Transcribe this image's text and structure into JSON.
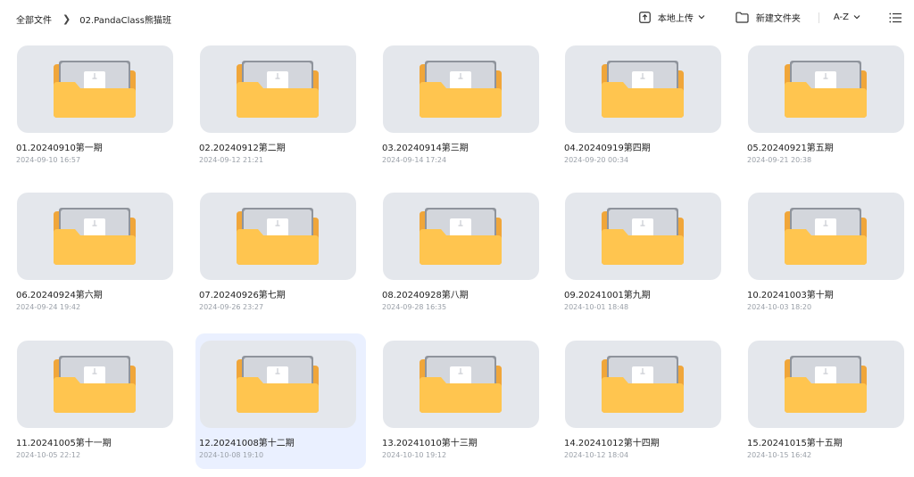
{
  "breadcrumb": {
    "root": "全部文件",
    "current": "02.PandaClass熊猫班"
  },
  "toolbar": {
    "upload_label": "本地上传",
    "new_folder_label": "新建文件夹",
    "sort_label": "A-Z",
    "icons": {
      "upload": "upload-icon",
      "folder": "folder-icon",
      "list": "list-view-icon"
    }
  },
  "colors": {
    "folder": "#ffc54f",
    "folder_back": "#f0a63a",
    "thumb_bg": "#e4e7ec",
    "selected_bg": "#eaf0ff"
  },
  "folders": [
    {
      "name": "01.20240910第一期",
      "date": "2024-09-10 16:57"
    },
    {
      "name": "02.20240912第二期",
      "date": "2024-09-12 21:21"
    },
    {
      "name": "03.20240914第三期",
      "date": "2024-09-14 17:24"
    },
    {
      "name": "04.20240919第四期",
      "date": "2024-09-20 00:34"
    },
    {
      "name": "05.20240921第五期",
      "date": "2024-09-21 20:38"
    },
    {
      "name": "06.20240924第六期",
      "date": "2024-09-24 19:42"
    },
    {
      "name": "07.20240926第七期",
      "date": "2024-09-26 23:27"
    },
    {
      "name": "08.20240928第八期",
      "date": "2024-09-28 16:35"
    },
    {
      "name": "09.20241001第九期",
      "date": "2024-10-01 18:48"
    },
    {
      "name": "10.20241003第十期",
      "date": "2024-10-03 18:20"
    },
    {
      "name": "11.20241005第十一期",
      "date": "2024-10-05 22:12"
    },
    {
      "name": "12.20241008第十二期",
      "date": "2024-10-08 19:10",
      "selected": true
    },
    {
      "name": "13.20241010第十三期",
      "date": "2024-10-10 19:12"
    },
    {
      "name": "14.20241012第十四期",
      "date": "2024-10-12 18:04"
    },
    {
      "name": "15.20241015第十五期",
      "date": "2024-10-15 16:42"
    }
  ]
}
